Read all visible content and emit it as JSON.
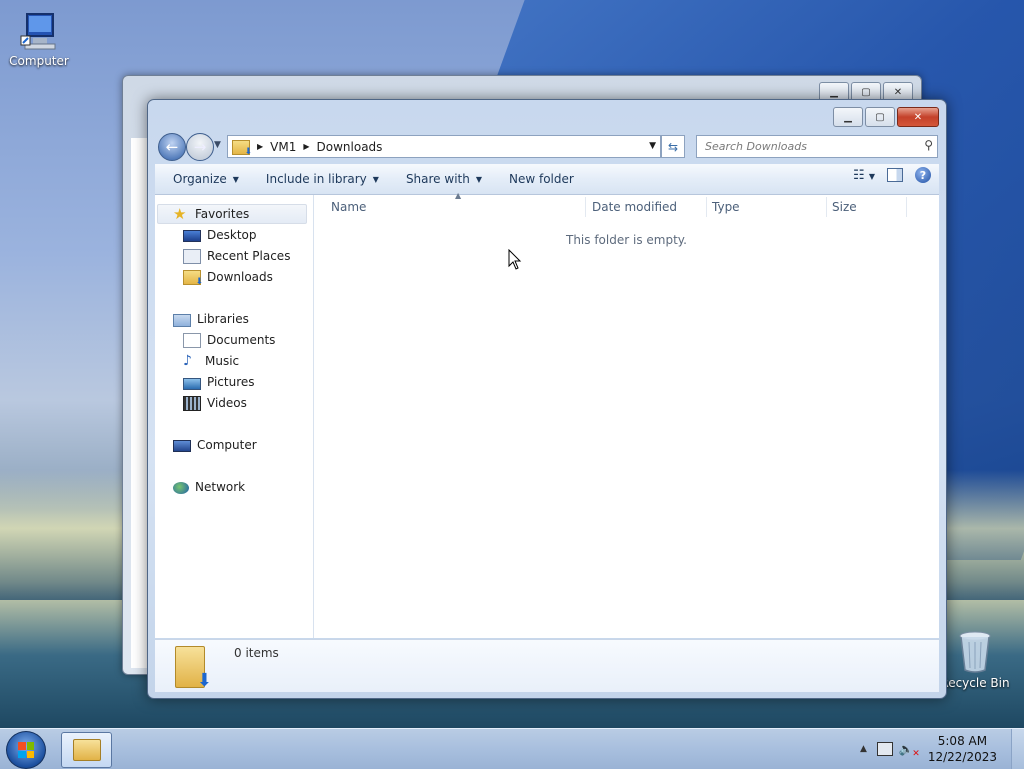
{
  "desktop": {
    "icons": [
      {
        "label": "Computer"
      },
      {
        "label": "Recycle Bin"
      }
    ]
  },
  "window": {
    "address": {
      "crumbs": [
        "VM1",
        "Downloads"
      ]
    },
    "search": {
      "placeholder": "Search Downloads"
    },
    "toolbar": {
      "organize": "Organize",
      "include_in_library": "Include in library",
      "share_with": "Share with",
      "new_folder": "New folder"
    },
    "nav": {
      "favorites": "Favorites",
      "desktop": "Desktop",
      "recent_places": "Recent Places",
      "downloads": "Downloads",
      "libraries": "Libraries",
      "documents": "Documents",
      "music": "Music",
      "pictures": "Pictures",
      "videos": "Videos",
      "computer": "Computer",
      "network": "Network"
    },
    "columns": [
      "Name",
      "Date modified",
      "Type",
      "Size"
    ],
    "empty_message": "This folder is empty.",
    "details": {
      "count": "0 items"
    }
  },
  "taskbar": {
    "time": "5:08 AM",
    "date": "12/22/2023"
  },
  "colors": {
    "accent": "#3a6ea8",
    "close_button": "#c4412a"
  },
  "icons": {
    "back": "back-arrow-icon",
    "forward": "forward-arrow-icon",
    "search": "search-icon",
    "help": "help-icon",
    "refresh": "refresh-icon"
  }
}
